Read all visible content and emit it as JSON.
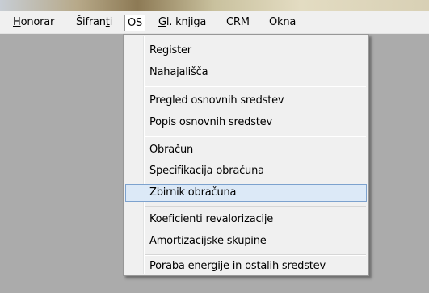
{
  "menubar": {
    "items": [
      {
        "label_acc": "H",
        "label_rest": "onorar"
      },
      {
        "label_pre": "Šifran",
        "label_acc": "t",
        "label_rest": "i"
      },
      {
        "label_pre": "",
        "label_acc": "",
        "label_rest": "OS"
      },
      {
        "label_acc": "G",
        "label_rest": "l. knjiga"
      },
      {
        "label_rest": "CRM"
      },
      {
        "label_rest": "Okna"
      }
    ]
  },
  "os_menu": {
    "items": [
      "Register",
      "Nahajališča",
      "Pregled osnovnih sredstev",
      "Popis osnovnih sredstev",
      "Obračun",
      "Specifikacija obračuna",
      "Zbirnik obračuna",
      "Koeficienti revalorizacije",
      "Amortizacijske skupine",
      "Poraba energije in ostalih sredstev"
    ],
    "highlighted_item": "Zbirnik obračuna"
  },
  "colors": {
    "menubar_bg": "#f0f0f0",
    "workspace_bg": "#ababab",
    "highlight_bg": "#dce9f7",
    "highlight_border": "#7da2ce"
  }
}
